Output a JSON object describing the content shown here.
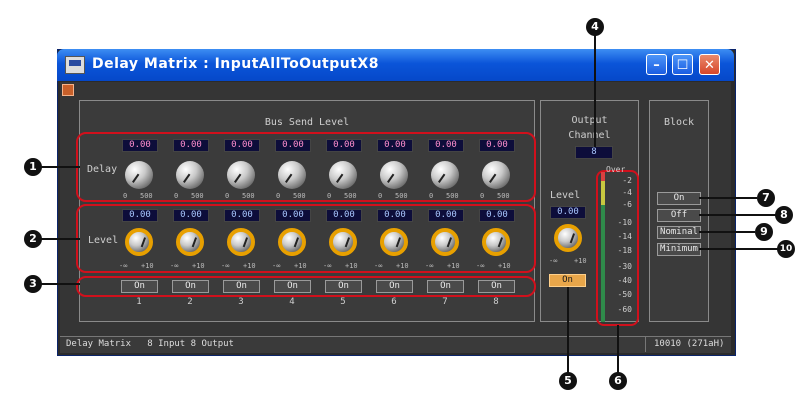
{
  "window": {
    "title": "Delay Matrix : InputAllToOutputX8",
    "minimize_icon": "minimize-icon",
    "maximize_icon": "maximize-icon",
    "close_icon": "close-icon"
  },
  "bus_send": {
    "title": "Bus Send Level",
    "delay_label": "Delay",
    "level_label": "Level",
    "delay_values": [
      "0.00",
      "0.00",
      "0.00",
      "0.00",
      "0.00",
      "0.00",
      "0.00",
      "0.00"
    ],
    "level_values": [
      "0.00",
      "0.00",
      "0.00",
      "0.00",
      "0.00",
      "0.00",
      "0.00",
      "0.00"
    ],
    "delay_range": [
      "0",
      "500"
    ],
    "level_range": [
      "-∞",
      "+10"
    ],
    "on_buttons": [
      "On",
      "On",
      "On",
      "On",
      "On",
      "On",
      "On",
      "On"
    ],
    "channels": [
      "1",
      "2",
      "3",
      "4",
      "5",
      "6",
      "7",
      "8"
    ]
  },
  "output": {
    "title": "Output",
    "channel_label": "Channel",
    "channel_value": "8",
    "level_label": "Level",
    "level_value": "0.00",
    "level_range": [
      "-∞",
      "+10"
    ],
    "on_button": "On",
    "meter_scale": [
      "Over",
      "-2",
      "-4",
      "-6",
      "-10",
      "-14",
      "-18",
      "-30",
      "-40",
      "-50",
      "-60"
    ]
  },
  "block": {
    "title": "Block",
    "buttons": [
      "On",
      "Off",
      "Nominal",
      "Minimum"
    ]
  },
  "status_bar": {
    "left": "Delay Matrix   8 Input 8 Output",
    "right": "10010 (271aH)"
  },
  "callouts": [
    "1",
    "2",
    "3",
    "4",
    "5",
    "6",
    "7",
    "8",
    "9",
    "10"
  ],
  "colors": {
    "accent_red": "#d1101c",
    "knob_ring": "#e8a000",
    "on_active": "#e8a64a",
    "value_pink": "#ff8fcf",
    "value_blue": "#a9c7ff"
  }
}
